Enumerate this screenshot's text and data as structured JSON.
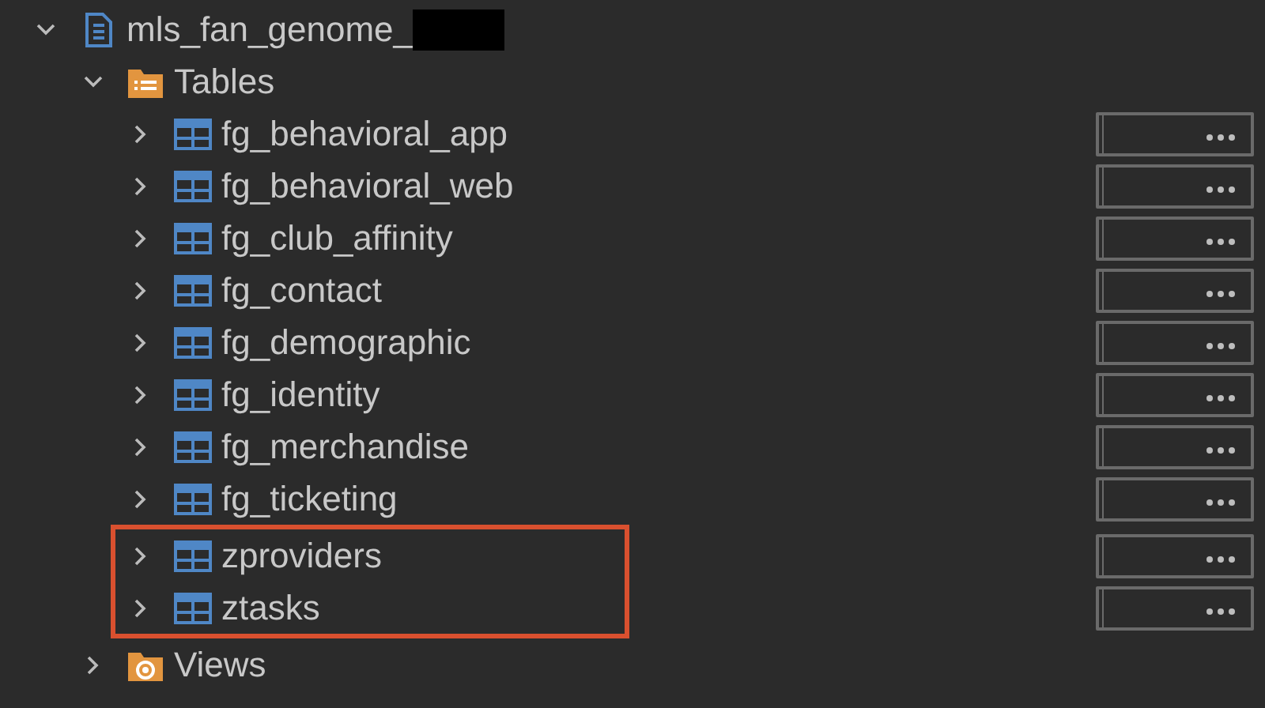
{
  "tree": [
    {
      "label": "mls_fan_genome_",
      "kind": "database",
      "expanded": true,
      "redacted": true,
      "children": [
        {
          "label": "Tables",
          "kind": "folder",
          "expanded": true,
          "children": [
            {
              "label": "fg_behavioral_app",
              "kind": "table",
              "expanded": false,
              "highlighted": false
            },
            {
              "label": "fg_behavioral_web",
              "kind": "table",
              "expanded": false,
              "highlighted": false
            },
            {
              "label": "fg_club_affinity",
              "kind": "table",
              "expanded": false,
              "highlighted": false
            },
            {
              "label": "fg_contact",
              "kind": "table",
              "expanded": false,
              "highlighted": false
            },
            {
              "label": "fg_demographic",
              "kind": "table",
              "expanded": false,
              "highlighted": false
            },
            {
              "label": "fg_identity",
              "kind": "table",
              "expanded": false,
              "highlighted": false
            },
            {
              "label": "fg_merchandise",
              "kind": "table",
              "expanded": false,
              "highlighted": false
            },
            {
              "label": "fg_ticketing",
              "kind": "table",
              "expanded": false,
              "highlighted": false
            },
            {
              "label": "zproviders",
              "kind": "table",
              "expanded": false,
              "highlighted": true
            },
            {
              "label": "ztasks",
              "kind": "table",
              "expanded": false,
              "highlighted": true
            }
          ]
        },
        {
          "label": "Views",
          "kind": "views",
          "expanded": false
        }
      ]
    }
  ]
}
